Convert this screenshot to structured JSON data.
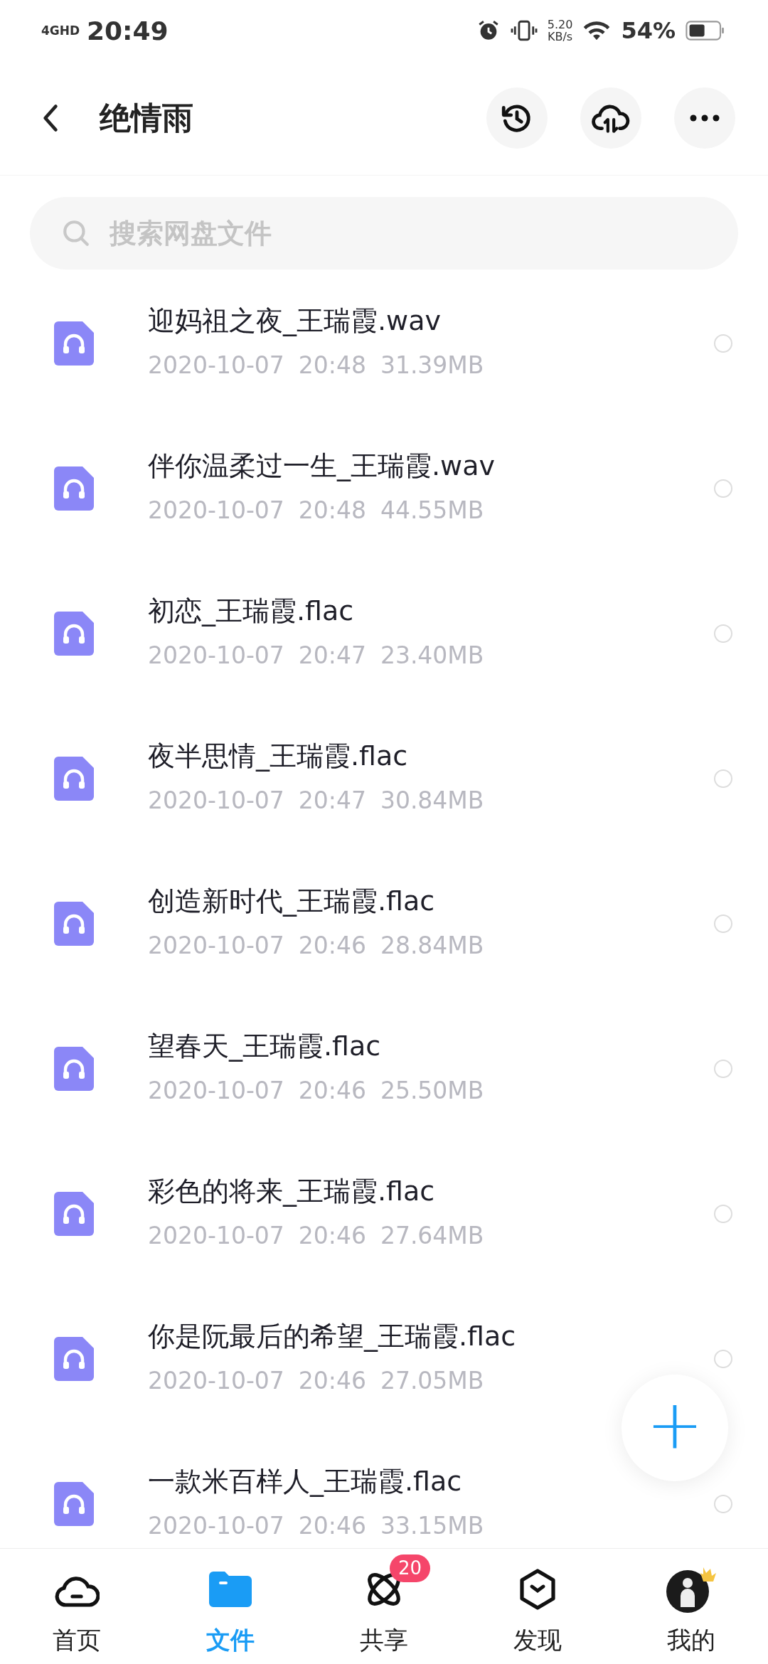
{
  "status_bar": {
    "network": "4GHD",
    "time": "20:49",
    "speed": "5.20",
    "speed_unit": "KB/s",
    "battery": "54%"
  },
  "header": {
    "title": "绝情雨"
  },
  "search": {
    "placeholder": "搜索网盘文件"
  },
  "files": [
    {
      "name": "迎妈祖之夜_王瑞霞.wav",
      "date": "2020-10-07",
      "time": "20:48",
      "size": "31.39MB",
      "selected": false
    },
    {
      "name": "伴你温柔过一生_王瑞霞.wav",
      "date": "2020-10-07",
      "time": "20:48",
      "size": "44.55MB",
      "selected": false
    },
    {
      "name": "初恋_王瑞霞.flac",
      "date": "2020-10-07",
      "time": "20:47",
      "size": "23.40MB",
      "selected": false
    },
    {
      "name": "夜半思情_王瑞霞.flac",
      "date": "2020-10-07",
      "time": "20:47",
      "size": "30.84MB",
      "selected": false
    },
    {
      "name": "创造新时代_王瑞霞.flac",
      "date": "2020-10-07",
      "time": "20:46",
      "size": "28.84MB",
      "selected": false
    },
    {
      "name": "望春天_王瑞霞.flac",
      "date": "2020-10-07",
      "time": "20:46",
      "size": "25.50MB",
      "selected": false
    },
    {
      "name": "彩色的将来_王瑞霞.flac",
      "date": "2020-10-07",
      "time": "20:46",
      "size": "27.64MB",
      "selected": false
    },
    {
      "name": "你是阮最后的希望_王瑞霞.flac",
      "date": "2020-10-07",
      "time": "20:46",
      "size": "27.05MB",
      "selected": false
    },
    {
      "name": "一款米百样人_王瑞霞.flac",
      "date": "2020-10-07",
      "time": "20:46",
      "size": "33.15MB",
      "selected": false
    }
  ],
  "fab": {
    "label": "+"
  },
  "nav": [
    {
      "kind": "home",
      "label": "首页",
      "selected": false
    },
    {
      "kind": "files",
      "label": "文件",
      "selected": true
    },
    {
      "kind": "share",
      "label": "共享",
      "selected": false,
      "badge": "20"
    },
    {
      "kind": "discover",
      "label": "发现",
      "selected": false
    },
    {
      "kind": "me",
      "label": "我的",
      "selected": false
    }
  ]
}
